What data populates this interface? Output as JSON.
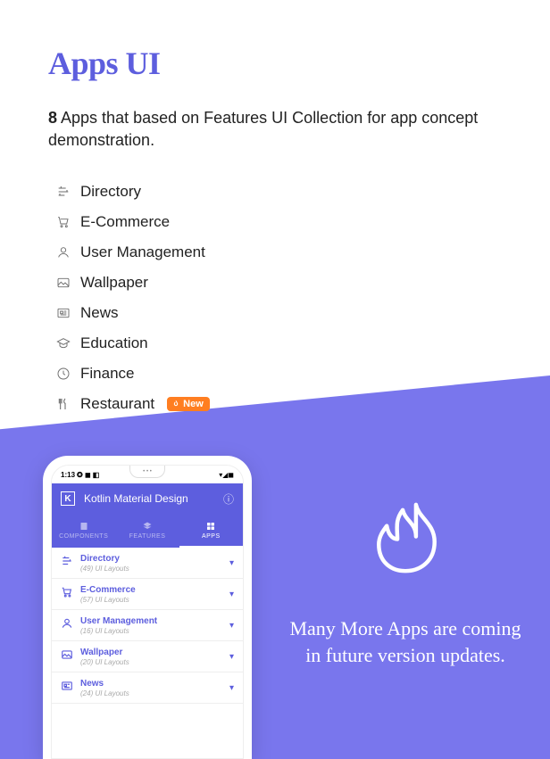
{
  "title": "Apps UI",
  "intro_count": "8",
  "intro_rest": " Apps that based on Features UI Collection for app concept demonstration.",
  "list": {
    "0": "Directory",
    "1": "E-Commerce",
    "2": "User Management",
    "3": "Wallpaper",
    "4": "News",
    "5": "Education",
    "6": "Finance",
    "7": "Restaurant"
  },
  "badge": "New",
  "phone": {
    "time": "1:13",
    "header": "Kotlin Material Design",
    "tabs": {
      "0": "COMPONENTS",
      "1": "FEATURES",
      "2": "APPS"
    },
    "items": {
      "0": {
        "title": "Directory",
        "sub": "(49) UI Layouts"
      },
      "1": {
        "title": "E-Commerce",
        "sub": "(57) UI Layouts"
      },
      "2": {
        "title": "User Management",
        "sub": "(16) UI Layouts"
      },
      "3": {
        "title": "Wallpaper",
        "sub": "(20) UI Layouts"
      },
      "4": {
        "title": "News",
        "sub": "(24) UI Layouts"
      }
    }
  },
  "callout": "Many More Apps are coming in future version updates."
}
